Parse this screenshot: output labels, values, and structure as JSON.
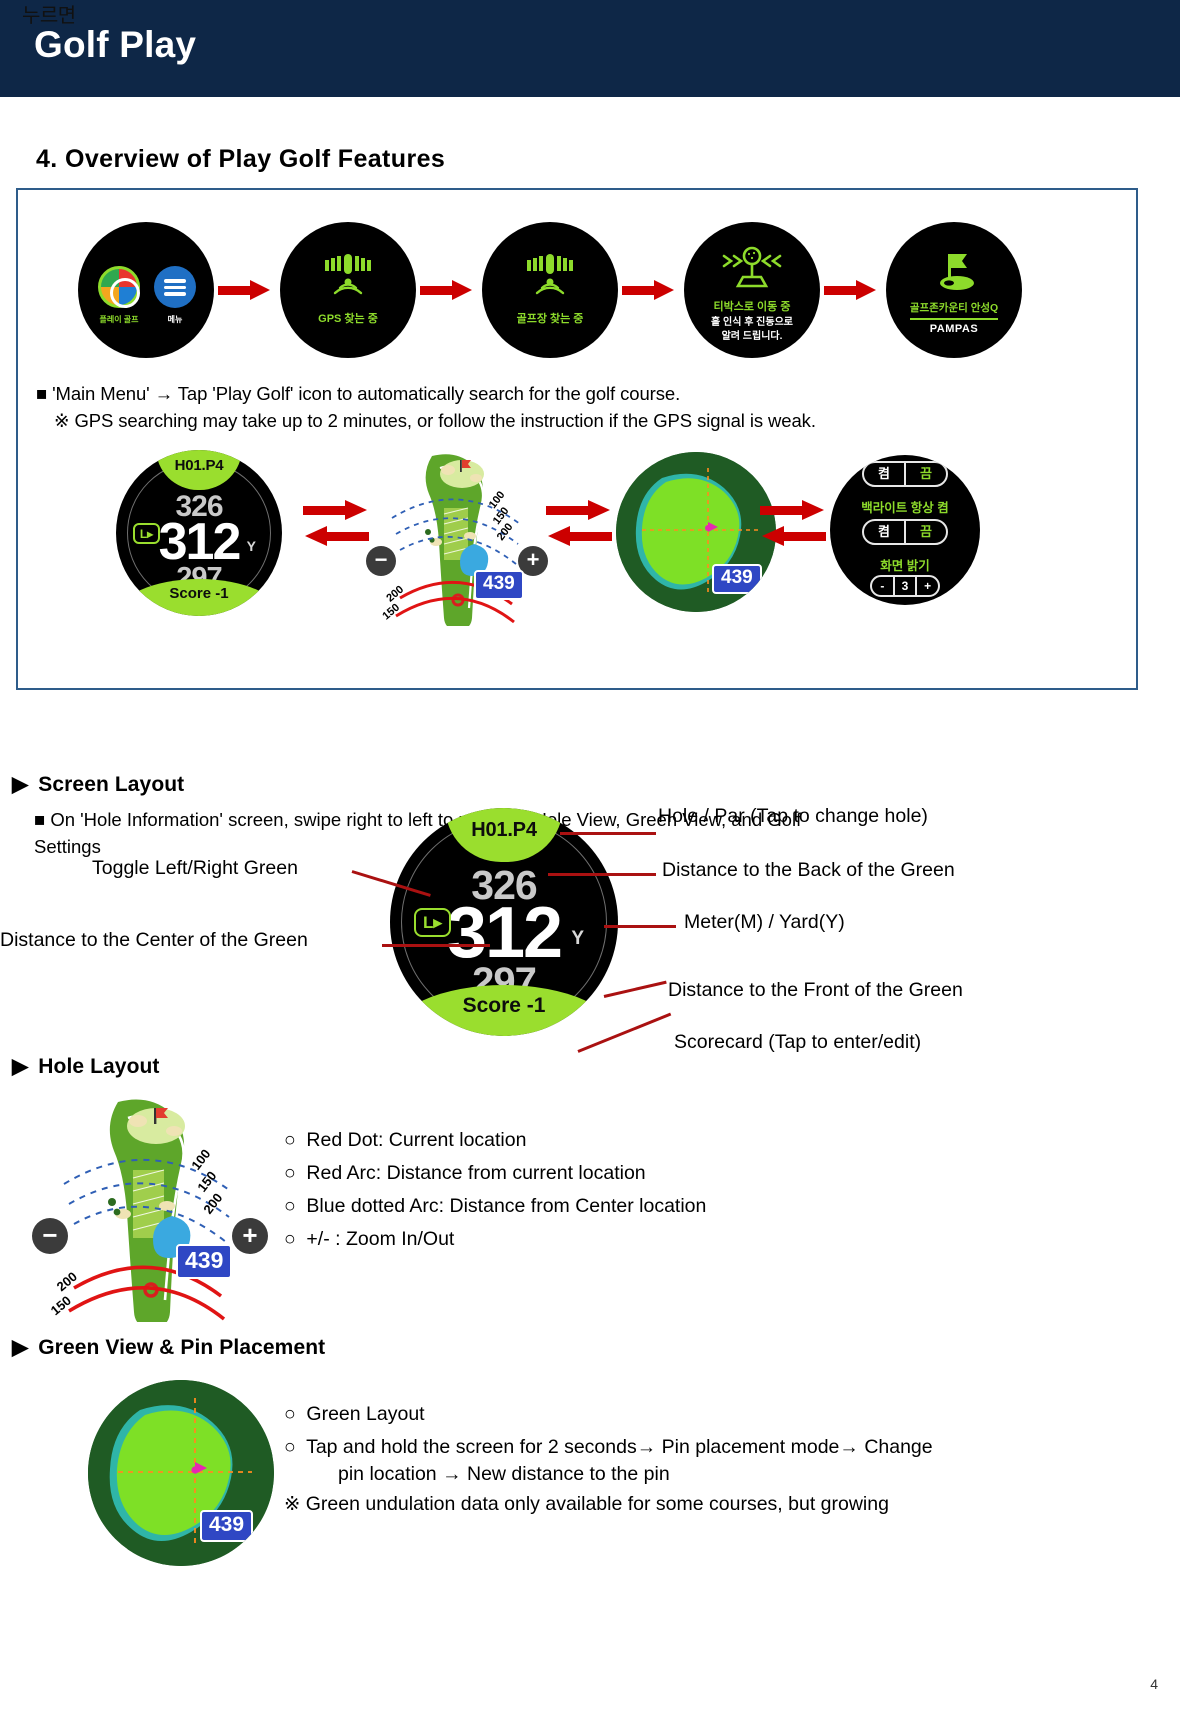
{
  "header": {
    "kicker": "누르면",
    "title": "Golf Play"
  },
  "section": {
    "number_title": "4. Overview of Play Golf Features"
  },
  "flow_row1": {
    "watch1": {
      "app_golf_label": "플레이 골프",
      "app_menu_label": "메뉴"
    },
    "watch2": {
      "caption": "GPS 찾는 중"
    },
    "watch3": {
      "caption": "골프장 찾는 중"
    },
    "watch4": {
      "caption": "티박스로 이동 중",
      "sub_line1": "홀 인식 후 진동으로",
      "sub_line2": "알려 드립니다."
    },
    "watch5": {
      "course_name": "골프존카운티 안성Q",
      "course_sub": "PAMPAS"
    },
    "note_line1": "■ 'Main Menu' → Tap 'Play Golf' icon to automatically search for the golf course.",
    "note_line2": "※ GPS searching may take up to 2 minutes, or follow the instruction if the GPS signal is weak."
  },
  "flow_row2": {
    "hole_watch": {
      "hole_par": "H01.P4",
      "distance_back": "326",
      "distance_center": "312",
      "unit": "Y",
      "distance_front": "297",
      "lr_toggle": "L",
      "score": "Score -1"
    },
    "hole_map": {
      "zoom_out": "−",
      "zoom_in": "+",
      "distance_chip": "439",
      "arc_labels_blue": [
        "100",
        "150",
        "200"
      ],
      "arc_labels_red": [
        "200",
        "150"
      ]
    },
    "green_view": {
      "distance_chip": "439"
    },
    "settings_watch": {
      "toggle1_on": "켬",
      "toggle1_off": "끔",
      "label1": "백라이트 항상 켬",
      "toggle2_on": "켬",
      "toggle2_off": "끔",
      "label2": "화면 밝기",
      "stepper_minus": "-",
      "stepper_value": "3",
      "stepper_plus": "+"
    },
    "note_line1": "■ On 'Hole Information' screen, swipe right to left to navigate Hole View, Green View, and Golf",
    "note_line2": "Settings"
  },
  "screen_layout": {
    "heading": "Screen Layout",
    "callouts": {
      "hole_par": "Hole / Par (Tap to change hole)",
      "back_green": "Distance to the Back of the Green",
      "meter_yard": "Meter(M) / Yard(Y)",
      "front_green": "Distance to the Front of the Green",
      "scorecard": "Scorecard (Tap to enter/edit)",
      "toggle_lr": "Toggle Left/Right Green",
      "center_green": "Distance to the Center of the Green"
    },
    "watch": {
      "hole_par": "H01.P4",
      "distance_back": "326",
      "distance_center": "312",
      "unit": "Y",
      "distance_front": "297",
      "lr_toggle": "L",
      "score": "Score -1"
    }
  },
  "hole_layout": {
    "heading": "Hole Layout",
    "bullets": [
      "Red Dot: Current location",
      "Red Arc: Distance from current location",
      "Blue dotted Arc: Distance from Center location",
      "+/-  : Zoom In/Out"
    ],
    "map": {
      "zoom_out": "−",
      "zoom_in": "+",
      "distance_chip": "439",
      "arc_labels_blue": [
        "100",
        "150",
        "200"
      ],
      "arc_labels_red": [
        "200",
        "150"
      ]
    }
  },
  "green_view_section": {
    "heading": "Green View & Pin Placement",
    "bullet1": "Green Layout",
    "bullet2_line1": "Tap and hold the screen for 2 seconds→ Pin placement mode→ Change",
    "bullet2_line2": "pin location → New distance to the pin",
    "note": "※ Green undulation data only available for some courses, but growing",
    "green_chip": "439"
  },
  "page_number": "4",
  "colors": {
    "header_bg": "#0e2747",
    "box_border": "#2e5c8a",
    "arrow_red": "#cc0000",
    "leader_red": "#aa1111",
    "watch_green": "#8ddb2b",
    "badge_green": "#9ade2e",
    "chip_blue": "#2f47c4"
  }
}
